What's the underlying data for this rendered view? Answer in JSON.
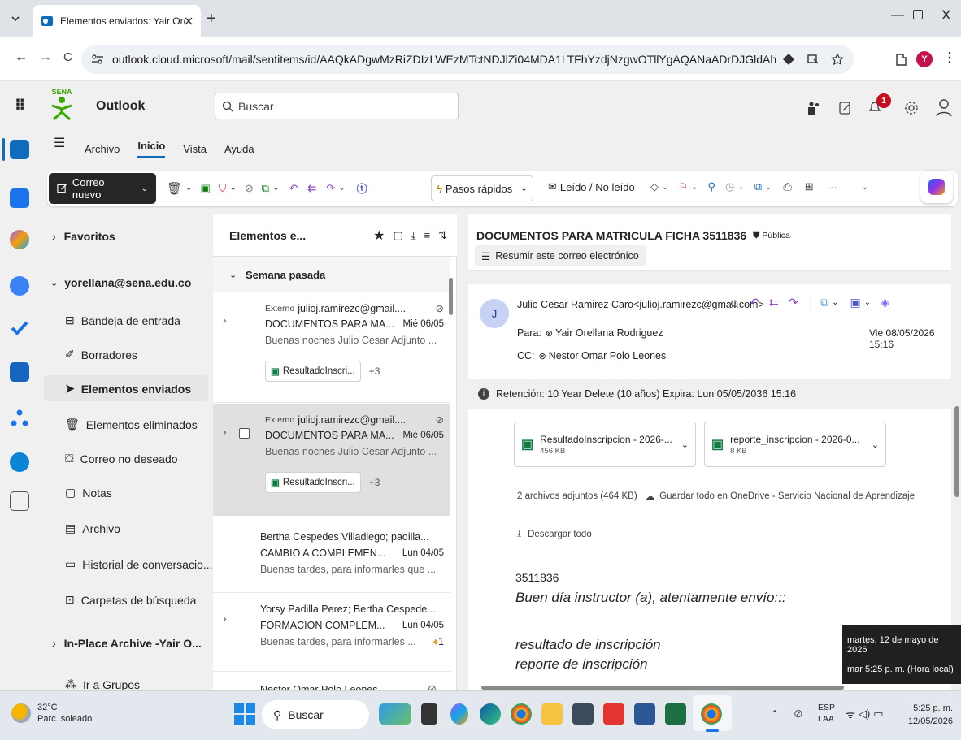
{
  "browser": {
    "tab_title": "Elementos enviados: Yair Orella",
    "url": "outlook.cloud.microsoft/mail/sentitems/id/AAQkADgwMzRiZDIzLWEzMTctNDJlZi04MDA1LTFhYzdjNzgwOTllYgAQANaADrDJGldAh6SMHVmgFpA%3D?cult...",
    "profile_initial": "Y"
  },
  "outlook": {
    "app_name": "Outlook",
    "brand_text": "SENA",
    "search_placeholder": "Buscar",
    "notification_count": "1",
    "menu_tabs": [
      "Archivo",
      "Inicio",
      "Vista",
      "Ayuda"
    ],
    "new_mail_label": "Correo nuevo",
    "quick_steps_label": "Pasos rápidos",
    "read_unread_label": "Leído / No leído",
    "more_label": "···"
  },
  "folders": {
    "favorites": "Favoritos",
    "account": "yorellana@sena.edu.co",
    "items": [
      "Bandeja de entrada",
      "Borradores",
      "Elementos enviados",
      "Elementos eliminados",
      "Correo no deseado",
      "Notas",
      "Archivo",
      "Historial de conversacio...",
      "Carpetas de búsqueda"
    ],
    "archive": "In-Place Archive -Yair O...",
    "groups": "Ir a Grupos"
  },
  "message_list": {
    "header_title": "Elementos e...",
    "group_label": "Semana pasada",
    "messages": [
      {
        "tag": "Externo",
        "from": "julioj.ramirezc@gmail....",
        "subject": "DOCUMENTOS PARA MA...",
        "date": "Mié 06/05",
        "preview": "Buenas noches Julio Cesar Adjunto ...",
        "attachment": "ResultadoInscri...",
        "extra": "+3"
      },
      {
        "tag": "Externo",
        "from": "julioj.ramirezc@gmail....",
        "subject": "DOCUMENTOS PARA MA...",
        "date": "Mié 06/05",
        "preview": "Buenas noches Julio Cesar Adjunto ...",
        "attachment": "ResultadoInscri...",
        "extra": "+3"
      },
      {
        "from": "Bertha Cespedes Villadiego; padilla...",
        "subject": "CAMBIO A COMPLEMEN...",
        "date": "Lun 04/05",
        "preview": "Buenas tardes, para informarles que ..."
      },
      {
        "from": "Yorsy Padilla Perez; Bertha Cespede...",
        "subject": "FORMACION COMPLEM...",
        "date": "Lun 04/05",
        "preview": "Buenas tardes, para informarles ...",
        "reaction": "1"
      },
      {
        "from": "Nestor Omar Polo Leones"
      }
    ]
  },
  "reading": {
    "subject": "DOCUMENTOS PARA MATRICULA FICHA 3511836",
    "visibility": "Pública",
    "summarize": "Resumir este correo electrónico",
    "avatar_initial": "J",
    "sender": "Julio Cesar Ramirez Caro<julioj.ramirezc@gmail.com>",
    "to_label": "Para:",
    "to": "Yair Orellana Rodriguez",
    "cc_label": "CC:",
    "cc": "Nestor Omar Polo Leones",
    "date": "Vie 08/05/2026 15:16",
    "retention": "Retención: 10 Year Delete (10 años) Expira: Lun 05/05/2036 15:16",
    "attachments": [
      {
        "name": "ResultadoInscripcion - 2026-...",
        "size": "456 KB"
      },
      {
        "name": "reporte_inscripcion - 2026-0...",
        "size": "8 KB"
      }
    ],
    "attach_summary": "2 archivos adjuntos (464 KB)",
    "save_onedrive": "Guardar todo en OneDrive - Servicio Nacional de Aprendizaje",
    "download_all": "Descargar todo",
    "body": [
      "3511836",
      "Buen día instructor (a), atentamente envío:::",
      "resultado de inscripción",
      "reporte de inscripción"
    ]
  },
  "tooltip": {
    "line1": "martes, 12 de mayo de 2026",
    "line2": "mar 5:25 p. m. (Hora local)"
  },
  "taskbar": {
    "weather_temp": "32°C",
    "weather_desc": "Parc. soleado",
    "search": "Buscar",
    "lang1": "ESP",
    "lang2": "LAA",
    "time": "5:25 p. m.",
    "date": "12/05/2026"
  }
}
